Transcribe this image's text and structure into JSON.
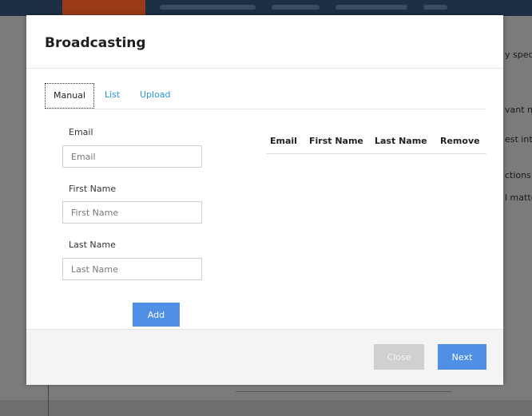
{
  "background": {
    "side_text": [
      "y spec",
      "vant n",
      "est int",
      "ctions",
      "l matte"
    ]
  },
  "modal": {
    "title": "Broadcasting",
    "tabs": [
      {
        "label": "Manual",
        "active": true
      },
      {
        "label": "List",
        "active": false
      },
      {
        "label": "Upload",
        "active": false
      }
    ],
    "form": {
      "email_label": "Email",
      "email_placeholder": "Email",
      "first_name_label": "First Name",
      "first_name_placeholder": "First Name",
      "last_name_label": "Last Name",
      "last_name_placeholder": "Last Name",
      "add_label": "Add"
    },
    "table": {
      "columns": [
        "Email",
        "First Name",
        "Last Name",
        "Remove"
      ],
      "rows": []
    },
    "footer": {
      "close_label": "Close",
      "next_label": "Next"
    }
  },
  "colors": {
    "accent": "#4f8fe6",
    "link": "#2a96d8",
    "disabled": "#d0d0d0"
  }
}
